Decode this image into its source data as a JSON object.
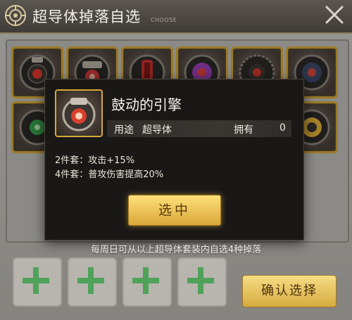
{
  "window": {
    "title": "超导体掉落自选",
    "subtitle": "CHOOSE"
  },
  "icons": {
    "emblem": "gear-emblem-icon",
    "close": "close-icon",
    "add": "plus-icon",
    "item": "superconductor-core-icon"
  },
  "colors": {
    "gold_border": "#d6a93a",
    "popup_bg": "#1a1816",
    "button_gold": "#f0c85a",
    "plus_green": "#4fa25a"
  },
  "grid": {
    "items": [
      {
        "name": "superconductor-item-1",
        "accent": "#e03a2b"
      },
      {
        "name": "superconductor-item-2",
        "accent": "#d43b3b"
      },
      {
        "name": "superconductor-item-3",
        "accent": "#c8302b"
      },
      {
        "name": "superconductor-item-4",
        "accent": "#9a3fb8"
      },
      {
        "name": "superconductor-item-5",
        "accent": "#d23a2e"
      },
      {
        "name": "superconductor-item-6",
        "accent": "#d64a3a"
      },
      {
        "name": "superconductor-item-7",
        "accent": "#3aa04e"
      },
      {
        "name": "superconductor-item-12",
        "accent": "#e3b23a"
      }
    ]
  },
  "popup": {
    "item_name": "鼓动的引擎",
    "use_label": "用途",
    "use_value": "超导体",
    "own_label": "拥有",
    "own_value": "0",
    "set2": "2件套：攻击+15%",
    "set4": "4件套：普攻伤害提高20%",
    "select_label": "选中"
  },
  "footer": {
    "hint": "每周日可从以上超导体套装内自选4种掉落",
    "confirm_label": "确认选择"
  }
}
